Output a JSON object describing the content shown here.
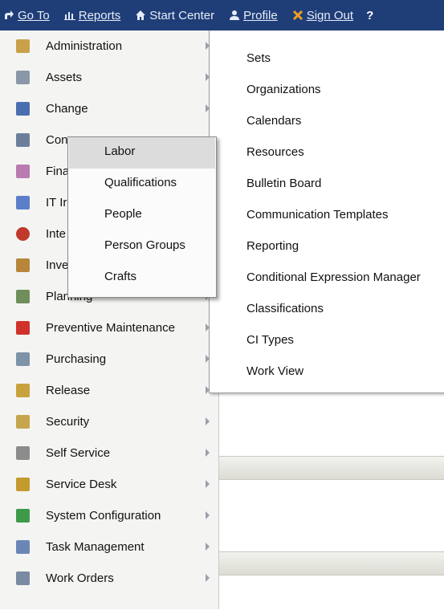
{
  "toolbar": {
    "goto": "Go To",
    "reports": "Reports",
    "start_center": "Start Center",
    "profile": "Profile",
    "sign_out": "Sign Out",
    "help": "?"
  },
  "main_menu": {
    "items": [
      {
        "label": "Administration",
        "icon": "administration-icon",
        "color": "#c9a14a"
      },
      {
        "label": "Assets",
        "icon": "assets-icon",
        "color": "#8a97a8"
      },
      {
        "label": "Change",
        "icon": "change-icon",
        "color": "#4a6fb0"
      },
      {
        "label": "Con",
        "icon": "contracts-icon",
        "color": "#6c7f9a"
      },
      {
        "label": "Fina",
        "icon": "financial-icon",
        "color": "#b97bb0"
      },
      {
        "label": "IT Ir",
        "icon": "it-infrastructure-icon",
        "color": "#5b7fc9"
      },
      {
        "label": "Inte",
        "icon": "integration-icon",
        "color": "#c0392b"
      },
      {
        "label": "Inve",
        "icon": "inventory-icon",
        "color": "#b8863b"
      },
      {
        "label": "Planning",
        "icon": "planning-icon",
        "color": "#6f8f5a"
      },
      {
        "label": "Preventive Maintenance",
        "icon": "preventive-maintenance-icon",
        "color": "#d0322b"
      },
      {
        "label": "Purchasing",
        "icon": "purchasing-icon",
        "color": "#7d93a8"
      },
      {
        "label": "Release",
        "icon": "release-icon",
        "color": "#c8a23c"
      },
      {
        "label": "Security",
        "icon": "security-icon",
        "color": "#c5a64d"
      },
      {
        "label": "Self Service",
        "icon": "self-service-icon",
        "color": "#8c8c8c"
      },
      {
        "label": "Service Desk",
        "icon": "service-desk-icon",
        "color": "#c49a2e"
      },
      {
        "label": "System Configuration",
        "icon": "system-configuration-icon",
        "color": "#3d9a4a"
      },
      {
        "label": "Task Management",
        "icon": "task-management-icon",
        "color": "#6b86b5"
      },
      {
        "label": "Work Orders",
        "icon": "work-orders-icon",
        "color": "#7b8aa3"
      }
    ]
  },
  "admin_submenu": {
    "items": [
      "Sets",
      "Organizations",
      "Calendars",
      "Resources",
      "Bulletin Board",
      "Communication Templates",
      "Reporting",
      "Conditional Expression Manager",
      "Classifications",
      "CI Types",
      "Work View"
    ]
  },
  "resources_popup": {
    "items": [
      "Labor",
      "Qualifications",
      "People",
      "Person Groups",
      "Crafts"
    ],
    "highlighted": "Labor"
  }
}
